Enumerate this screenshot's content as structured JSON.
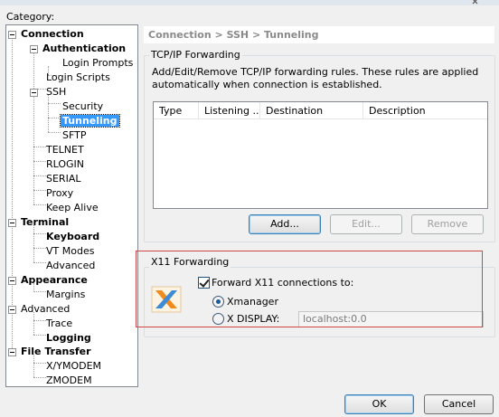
{
  "category_label": "Category:",
  "tree": {
    "connection": "Connection",
    "authentication": "Authentication",
    "login_prompts": "Login Prompts",
    "login_scripts": "Login Scripts",
    "ssh": "SSH",
    "security": "Security",
    "tunneling": "Tunneling",
    "sftp": "SFTP",
    "telnet": "TELNET",
    "rlogin": "RLOGIN",
    "serial": "SERIAL",
    "proxy": "Proxy",
    "keep_alive": "Keep Alive",
    "terminal": "Terminal",
    "keyboard": "Keyboard",
    "vt_modes": "VT Modes",
    "terminal_advanced": "Advanced",
    "appearance": "Appearance",
    "margins": "Margins",
    "advanced": "Advanced",
    "trace": "Trace",
    "logging": "Logging",
    "file_transfer": "File Transfer",
    "xymodem": "X/YMODEM",
    "zmodem": "ZMODEM"
  },
  "panel_title": "Connection > SSH > Tunneling",
  "tcpip": {
    "legend": "TCP/IP Forwarding",
    "description": "Add/Edit/Remove TCP/IP forwarding rules. These rules are applied automatically when connection is established.",
    "columns": [
      "Type",
      "Listening ...",
      "Destination",
      "Description"
    ],
    "add": "Add...",
    "edit": "Edit...",
    "remove": "Remove"
  },
  "x11": {
    "legend": "X11 Forwarding",
    "forward_label": "Forward X11 connections to:",
    "forward_checked": true,
    "xmanager_label": "Xmanager",
    "xdisplay_label": "X DISPLAY:",
    "selected": "Xmanager",
    "xdisplay_value": "localhost:0.0"
  },
  "footer": {
    "ok": "OK",
    "cancel": "Cancel"
  },
  "colors": {
    "selection": "#3399ff",
    "highlight_box": "#d04545"
  }
}
